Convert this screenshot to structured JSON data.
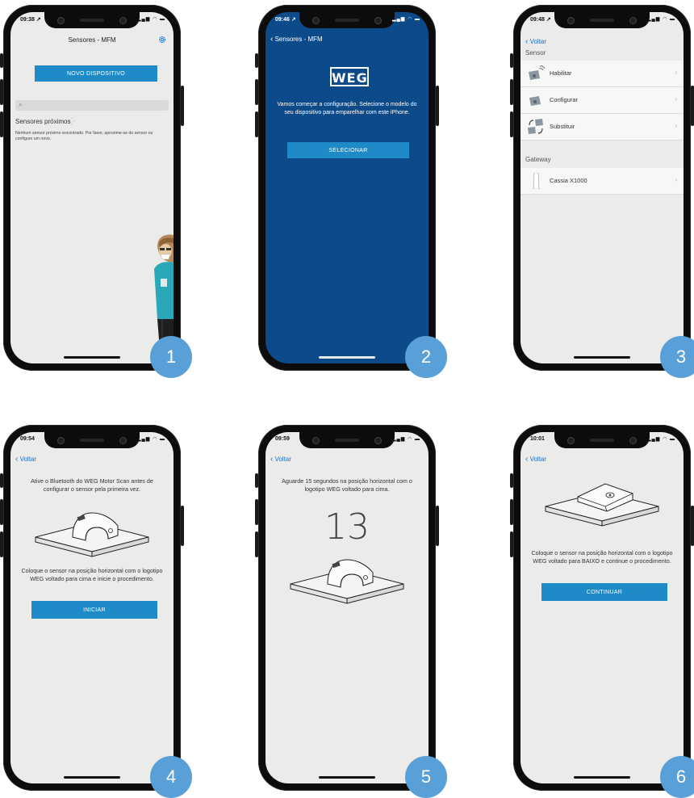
{
  "colors": {
    "accent": "#1e8ac7",
    "badge": "#5aa0d8",
    "blue_screen": "#0d4a8a",
    "link": "#1c6fc7"
  },
  "screens": [
    {
      "badge": "1",
      "time": "09:38 ↗",
      "title": "Sensores - MFM",
      "button": "NOVO DISPOSITIVO",
      "section": "Sensores próximos",
      "empty_msg": "Nenhum sensor próximo encontrado. Por favor, aproxime-se do sensor ou configure um novo.",
      "icons": [
        "gear-icon",
        "search-icon",
        "spinner-icon"
      ]
    },
    {
      "badge": "2",
      "time": "09:46 ↗",
      "back": "Sensores - MFM",
      "logo": "WEG",
      "message": "Vamos começar a configuração. Selecione o modelo do seu dispositivo para emparelhar com este iPhone.",
      "button": "SELECIONAR"
    },
    {
      "badge": "3",
      "time": "09:48 ↗",
      "back": "Voltar",
      "section_sensor": "Sensor",
      "items": [
        {
          "label": "Habilitar"
        },
        {
          "label": "Configurar"
        },
        {
          "label": "Substituir"
        }
      ],
      "section_gateway": "Gateway",
      "gateway_item": "Cassia X1000"
    },
    {
      "badge": "4",
      "time": "09:54",
      "back": "Voltar",
      "intro": "Ative o Bluetooth do WEG Motor Scan antes de configurar o sensor pela primeira vez.",
      "instruction": "Coloque o sensor na posição horizontal com o logotipo WEG voltado para cima e inicie o procedimento.",
      "button": "INICIAR"
    },
    {
      "badge": "5",
      "time": "09:59",
      "back": "Voltar",
      "message": "Aguarde 15 segundos na posição horizontal com o logotipo WEG voltado para cima.",
      "countdown": "13"
    },
    {
      "badge": "6",
      "time": "10:01",
      "back": "Voltar",
      "message": "Coloque o sensor na posição horizontal com o logotipo WEG voltado para BAIXO e continue o procedimento.",
      "button": "CONTINUAR"
    }
  ]
}
